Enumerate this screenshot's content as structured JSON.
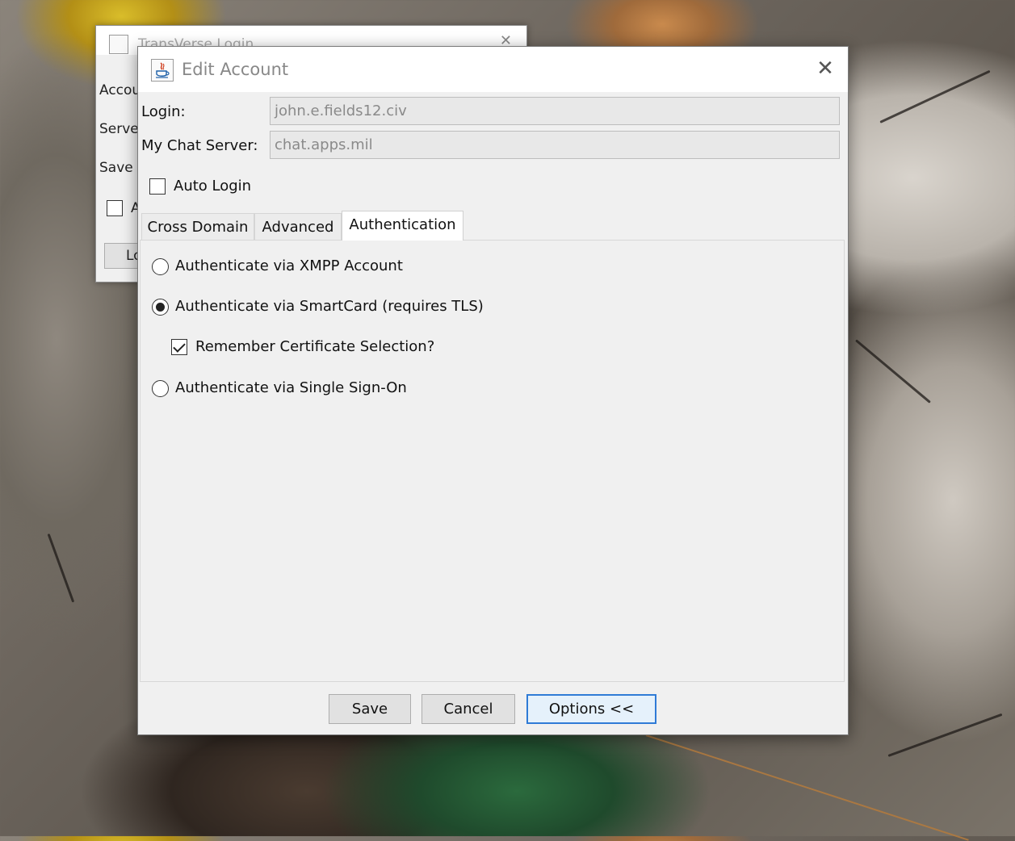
{
  "background_window": {
    "title": "TransVerse Login",
    "labels": [
      "Accou",
      "Serve",
      "Save"
    ],
    "checkbox_label": "A",
    "button_label": "Lo"
  },
  "dialog": {
    "title": "Edit Account",
    "close_label": "✕",
    "login_label": "Login:",
    "login_value": "john.e.fields12.civ",
    "server_label": "My Chat Server:",
    "server_value": "chat.apps.mil",
    "auto_login_label": "Auto Login",
    "auto_login_checked": false
  },
  "tabs": [
    {
      "label": "Cross Domain",
      "active": false
    },
    {
      "label": "Advanced",
      "active": false
    },
    {
      "label": "Authentication",
      "active": true
    }
  ],
  "auth": {
    "options": [
      {
        "label": "Authenticate via XMPP Account",
        "selected": false
      },
      {
        "label": "Authenticate via SmartCard (requires TLS)",
        "selected": true
      },
      {
        "label": "Authenticate via Single Sign-On",
        "selected": false
      }
    ],
    "remember_cert_label": "Remember Certificate Selection?",
    "remember_cert_checked": true
  },
  "buttons": {
    "save": "Save",
    "cancel": "Cancel",
    "options": "Options <<"
  },
  "colors": {
    "dialog_bg": "#f0f0f0",
    "default_button_border": "#2f7bd6"
  }
}
